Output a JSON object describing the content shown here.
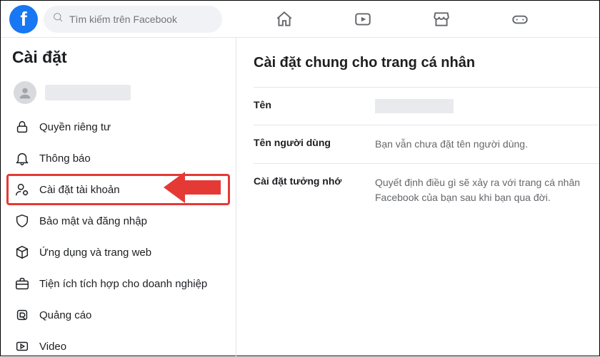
{
  "header": {
    "search_placeholder": "Tìm kiếm trên Facebook"
  },
  "sidebar": {
    "title": "Cài đặt",
    "items": [
      {
        "key": "profile",
        "label": ""
      },
      {
        "key": "privacy",
        "label": "Quyền riêng tư"
      },
      {
        "key": "notifications",
        "label": "Thông báo"
      },
      {
        "key": "account",
        "label": "Cài đặt tài khoản"
      },
      {
        "key": "security",
        "label": "Bảo mật và đăng nhập"
      },
      {
        "key": "apps",
        "label": "Ứng dụng và trang web"
      },
      {
        "key": "business",
        "label": "Tiện ích tích hợp cho doanh nghiệp"
      },
      {
        "key": "ads",
        "label": "Quảng cáo"
      },
      {
        "key": "video",
        "label": "Video"
      }
    ]
  },
  "content": {
    "title": "Cài đặt chung cho trang cá nhân",
    "rows": [
      {
        "label": "Tên",
        "value": ""
      },
      {
        "label": "Tên người dùng",
        "value": "Bạn vẫn chưa đặt tên người dùng."
      },
      {
        "label": "Cài đặt tưởng nhớ",
        "value": "Quyết định điều gì sẽ xảy ra với trang cá nhân Facebook của bạn sau khi bạn qua đời."
      }
    ]
  },
  "colors": {
    "brand": "#1877f2",
    "highlight": "#e53935"
  }
}
